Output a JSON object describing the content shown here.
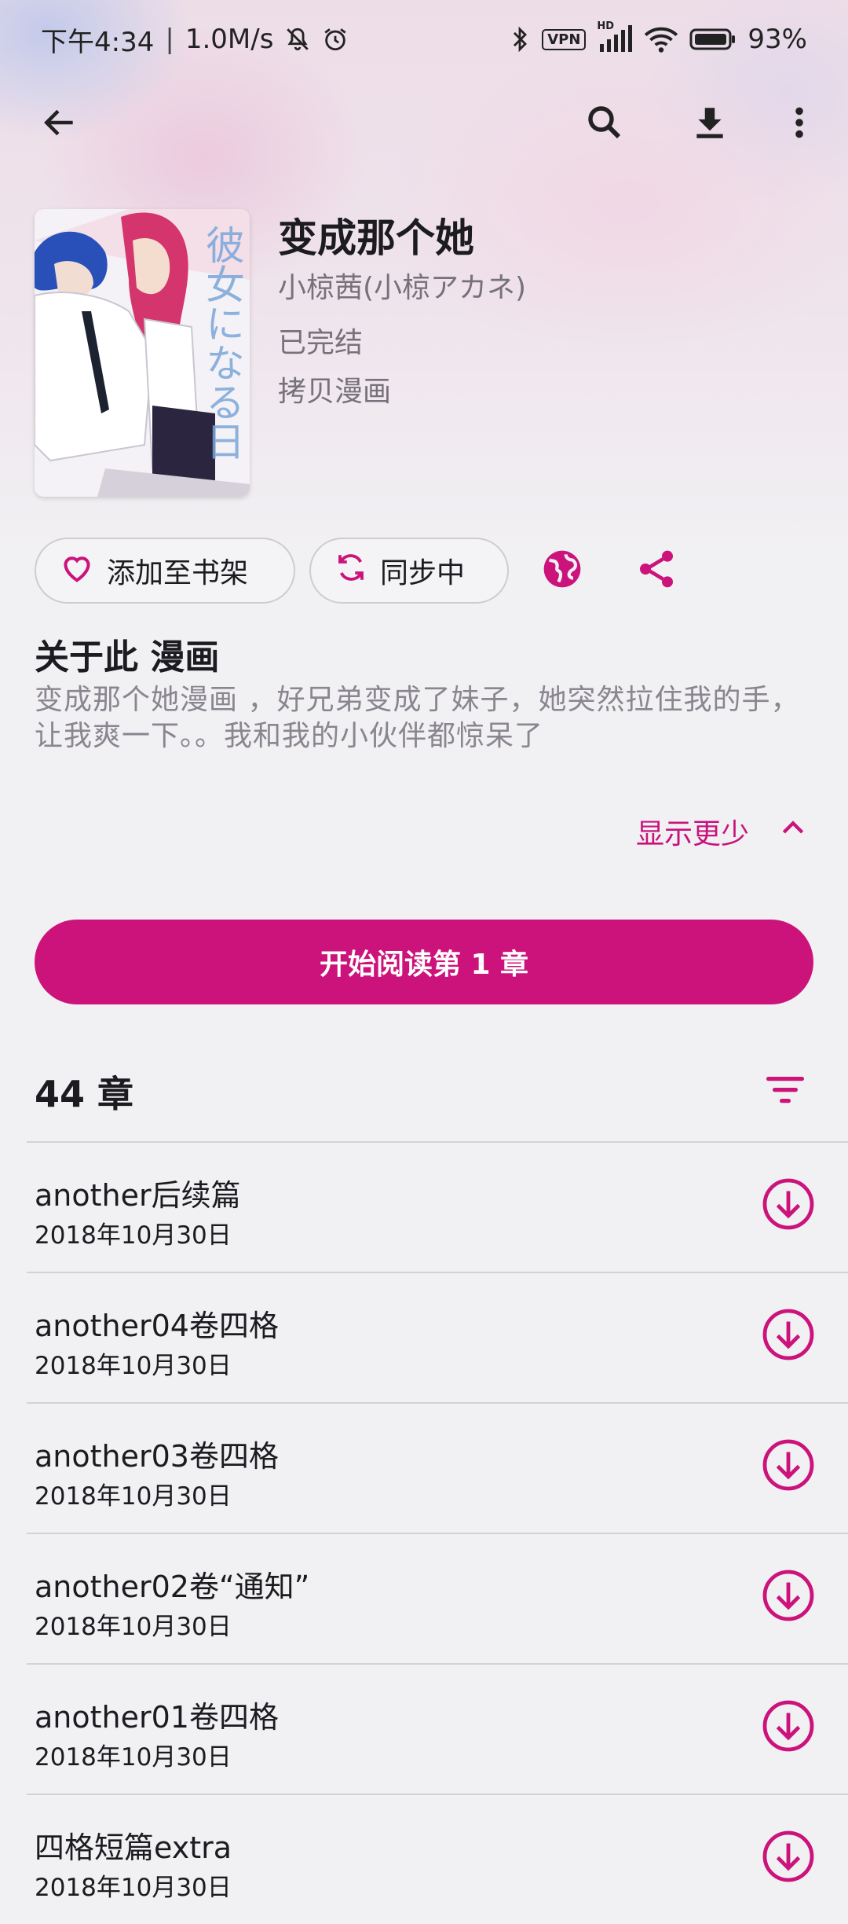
{
  "status_bar": {
    "time": "下午4:34",
    "net_speed": "1.0M/s",
    "vpn": "VPN",
    "hd": "HD",
    "battery": "93%"
  },
  "app_bar": {
    "icons": [
      "back-arrow-icon",
      "search-icon",
      "download-icon",
      "more-vert-icon"
    ]
  },
  "manga": {
    "title": "变成那个她",
    "author": "小椋茜(小椋アカネ)",
    "status": "已完结",
    "source": "拷贝漫画",
    "cover_text": "彼女になる日"
  },
  "actions": {
    "add_library": "添加至书架",
    "sync": "同步中"
  },
  "about": {
    "heading": "关于此 漫画",
    "description": "变成那个她漫画 ，好兄弟变成了妹子，她突然拉住我的手，让我爽一下。。我和我的小伙伴都惊呆了",
    "show_less": "显示更少"
  },
  "start_reading": "开始阅读第 1 章",
  "chapters": {
    "count_label": "44 章",
    "items": [
      {
        "name": "another后续篇",
        "date": "2018年10月30日"
      },
      {
        "name": "another04卷四格",
        "date": "2018年10月30日"
      },
      {
        "name": "another03卷四格",
        "date": "2018年10月30日"
      },
      {
        "name": "another02卷“通知”",
        "date": "2018年10月30日"
      },
      {
        "name": "another01卷四格",
        "date": "2018年10月30日"
      },
      {
        "name": "四格短篇extra",
        "date": "2018年10月30日"
      }
    ]
  },
  "colors": {
    "accent": "#cb137b",
    "background": "#f1f0f3"
  }
}
